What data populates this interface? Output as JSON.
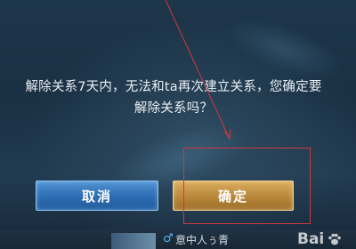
{
  "dialog": {
    "message_line1": "解除关系7天内，无法和ta再次建立关系，您确定要",
    "message_line2": "解除关系吗？"
  },
  "buttons": {
    "cancel_label": "取消",
    "confirm_label": "确定"
  },
  "player": {
    "name": "意中人ぅ青",
    "gender_icon": "male-icon"
  },
  "watermark": {
    "text": "Bai"
  },
  "colors": {
    "cancel_button": "#2f6fb4",
    "confirm_button": "#b9873a",
    "annotation_red": "#d0393f"
  }
}
